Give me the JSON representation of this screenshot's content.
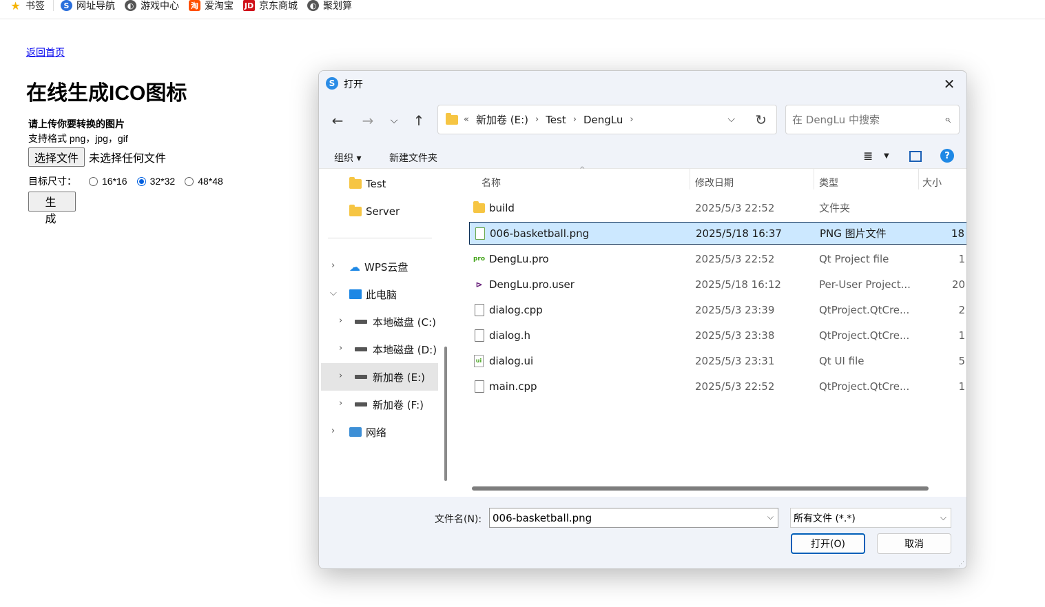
{
  "bookmarks": [
    {
      "label": "书签",
      "icon": "star-icon"
    },
    {
      "label": "网址导航",
      "icon": "sogou-icon"
    },
    {
      "label": "游戏中心",
      "icon": "game-icon"
    },
    {
      "label": "爱淘宝",
      "icon": "taobao-icon"
    },
    {
      "label": "京东商城",
      "icon": "jd-icon"
    },
    {
      "label": "聚划算",
      "icon": "juhuasuan-icon"
    }
  ],
  "page": {
    "back_link": "返回首页",
    "title": "在线生成ICO图标",
    "upload_title": "请上传你要转换的图片",
    "upload_hint": "支持格式 png，jpg，gif",
    "choose_file_label": "选择文件",
    "file_status": "未选择任何文件",
    "size_label": "目标尺寸：",
    "size_options": [
      "16*16",
      "32*32",
      "48*48"
    ],
    "size_selected": "32*32",
    "generate_label": "生　成"
  },
  "dialog": {
    "title": "打开",
    "address": {
      "overflow": "«",
      "crumbs": [
        "新加卷 (E:)",
        "Test",
        "DengLu"
      ]
    },
    "search_placeholder": "在 DengLu 中搜索",
    "commands": {
      "organize": "组织 ▾",
      "new_folder": "新建文件夹"
    },
    "nav_pane": [
      {
        "label": "Test",
        "icon": "folder-icon"
      },
      {
        "label": "Server",
        "icon": "folder-icon"
      },
      {
        "label": "WPS云盘",
        "icon": "cloud-icon"
      },
      {
        "label": "此电脑",
        "icon": "computer-icon"
      },
      {
        "label": "本地磁盘 (C:)",
        "icon": "drive-icon"
      },
      {
        "label": "本地磁盘 (D:)",
        "icon": "drive-icon"
      },
      {
        "label": "新加卷 (E:)",
        "icon": "drive-icon"
      },
      {
        "label": "新加卷 (F:)",
        "icon": "drive-icon"
      },
      {
        "label": "网络",
        "icon": "network-icon"
      }
    ],
    "columns": [
      "名称",
      "修改日期",
      "类型",
      "大小"
    ],
    "files": [
      {
        "name": "build",
        "date": "2025/5/3 22:52",
        "type": "文件夹",
        "size": "",
        "icon": "folder-icon"
      },
      {
        "name": "006-basketball.png",
        "date": "2025/5/18 16:37",
        "type": "PNG 图片文件",
        "size": "18",
        "icon": "png-icon"
      },
      {
        "name": "DengLu.pro",
        "date": "2025/5/3 22:52",
        "type": "Qt Project file",
        "size": "1",
        "icon": "qt-pro-icon"
      },
      {
        "name": "DengLu.pro.user",
        "date": "2025/5/18 16:12",
        "type": "Per-User Project...",
        "size": "20",
        "icon": "vs-icon"
      },
      {
        "name": "dialog.cpp",
        "date": "2025/5/3 23:39",
        "type": "QtProject.QtCre...",
        "size": "2",
        "icon": "file-icon"
      },
      {
        "name": "dialog.h",
        "date": "2025/5/3 23:38",
        "type": "QtProject.QtCre...",
        "size": "1",
        "icon": "file-icon"
      },
      {
        "name": "dialog.ui",
        "date": "2025/5/3 23:31",
        "type": "Qt UI file",
        "size": "5",
        "icon": "qt-ui-icon"
      },
      {
        "name": "main.cpp",
        "date": "2025/5/3 22:52",
        "type": "QtProject.QtCre...",
        "size": "1",
        "icon": "file-icon"
      }
    ],
    "selected_file": "006-basketball.png",
    "filename_label": "文件名(N):",
    "filename_value": "006-basketball.png",
    "filter_value": "所有文件 (*.*)",
    "open_label": "打开(O)",
    "cancel_label": "取消"
  }
}
